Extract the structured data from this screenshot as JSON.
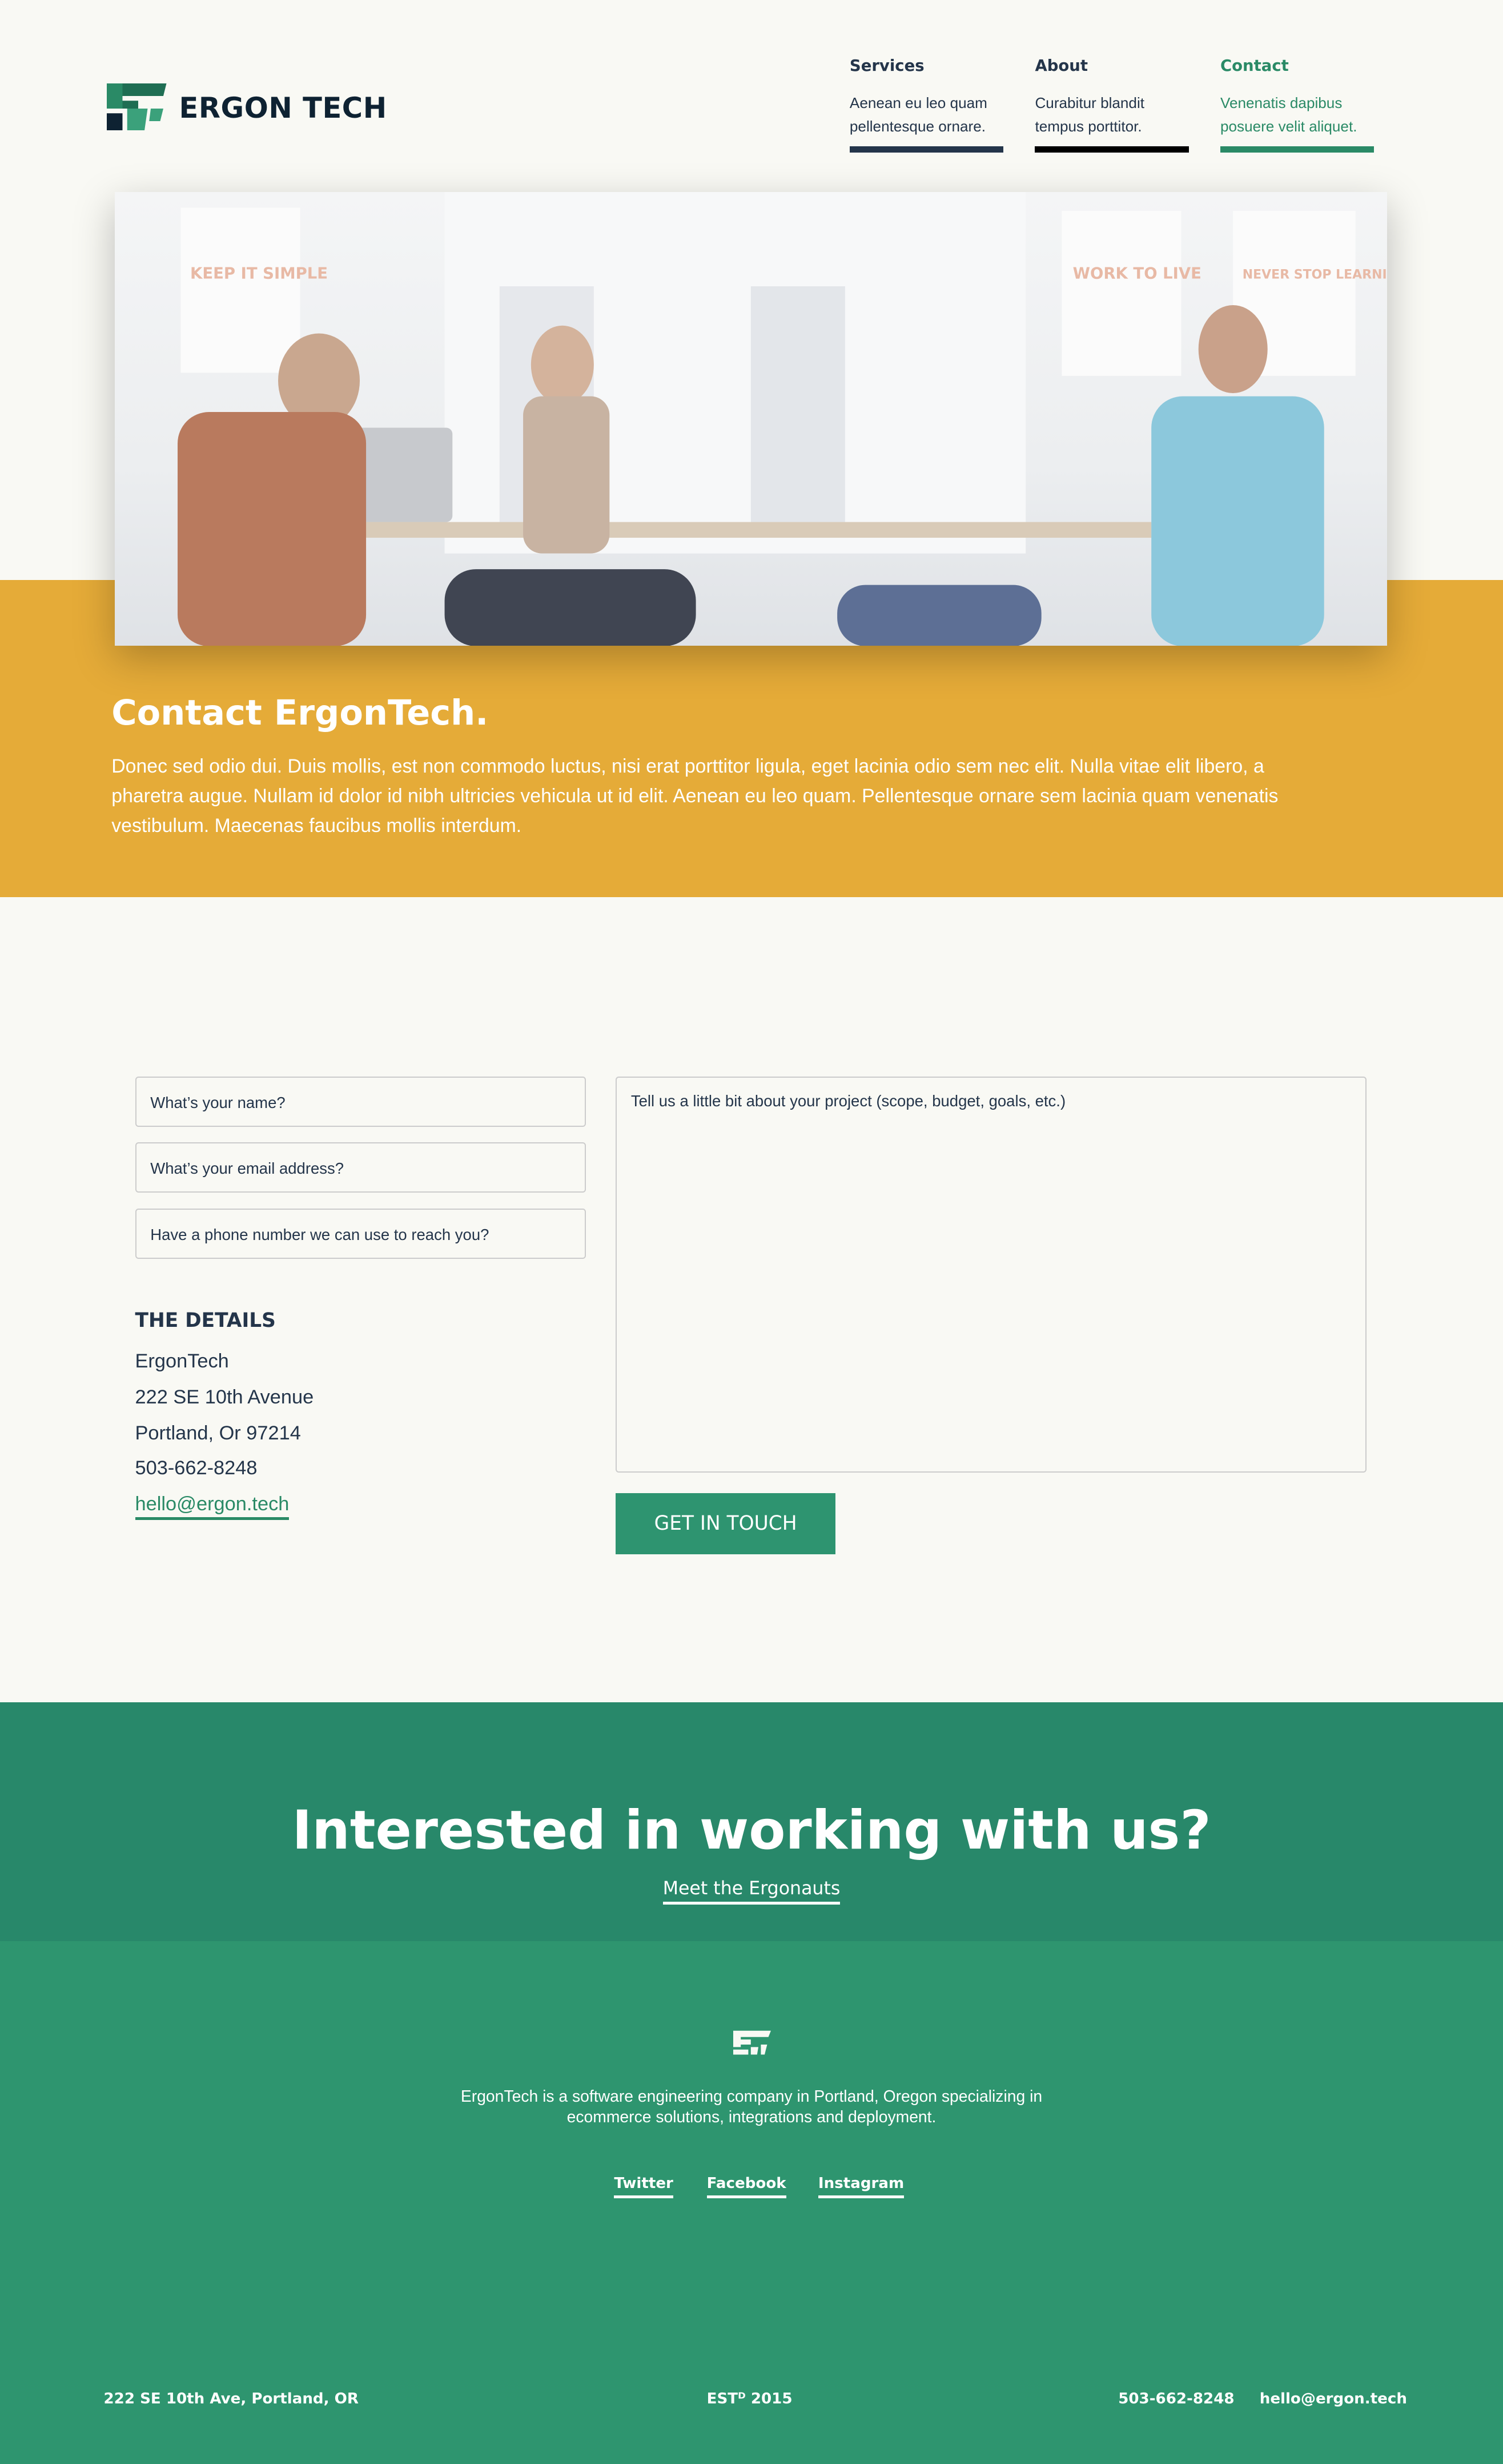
{
  "header": {
    "logo_text": "ERGON TECH",
    "nav": [
      {
        "title": "Services",
        "desc1": "Aenean eu leo quam",
        "desc2": "pellentesque ornare.",
        "color": "#24354A",
        "bar": "#24354A"
      },
      {
        "title": "About",
        "desc1": "Curabitur blandit",
        "desc2": "tempus porttitor.",
        "color": "#24354A",
        "bar": "#000000"
      },
      {
        "title": "Contact",
        "desc1": "Venenatis dapibus",
        "desc2": "posuere velit aliquet.",
        "color": "#2A8A66",
        "bar": "#2A8A66"
      }
    ]
  },
  "hero": {
    "posters": [
      "KEEP IT SIMPLE",
      "WORK TO LIVE",
      "NEVER STOP LEARNING"
    ]
  },
  "intro": {
    "title": "Contact ErgonTech.",
    "body": "Donec sed odio dui. Duis mollis, est non commodo luctus, nisi erat porttitor ligula, eget lacinia odio sem nec elit. Nulla vitae elit libero, a pharetra augue. Nullam id dolor id nibh ultricies vehicula ut id elit. Aenean eu leo quam. Pellentesque ornare sem lacinia quam venenatis vestibulum. Maecenas faucibus mollis interdum."
  },
  "form": {
    "name_placeholder": "What’s your name?",
    "email_placeholder": "What’s your email address?",
    "phone_placeholder": "Have a phone number we can use to reach you?",
    "message_placeholder": "Tell us a little bit about your project (scope, budget, goals, etc.)",
    "submit": "GET IN TOUCH"
  },
  "details": {
    "title": "THE DETAILS",
    "company": "ErgonTech",
    "street": "222 SE 10th Avenue",
    "city": "Portland, Or 97214",
    "phone": "503-662-8248",
    "email": "hello@ergon.tech"
  },
  "cta": {
    "title": "Interested in working with us?",
    "link": "Meet the Ergonauts"
  },
  "footer": {
    "about1": "ErgonTech is a software engineering company in Portland, Oregon specializing in",
    "about2": "ecommerce solutions, integrations and deployment.",
    "social": [
      "Twitter",
      "Facebook",
      "Instagram"
    ],
    "address": "222 SE 10th Ave, Portland, OR",
    "established": "ESTᴰ 2015",
    "phone": "503-662-8248",
    "email": "hello@ergon.tech"
  },
  "colors": {
    "background": "#F9F9F4",
    "yellow": "#E5AB38",
    "green": "#2E956F",
    "dark_green": "#28886A",
    "navy": "#24354A"
  }
}
